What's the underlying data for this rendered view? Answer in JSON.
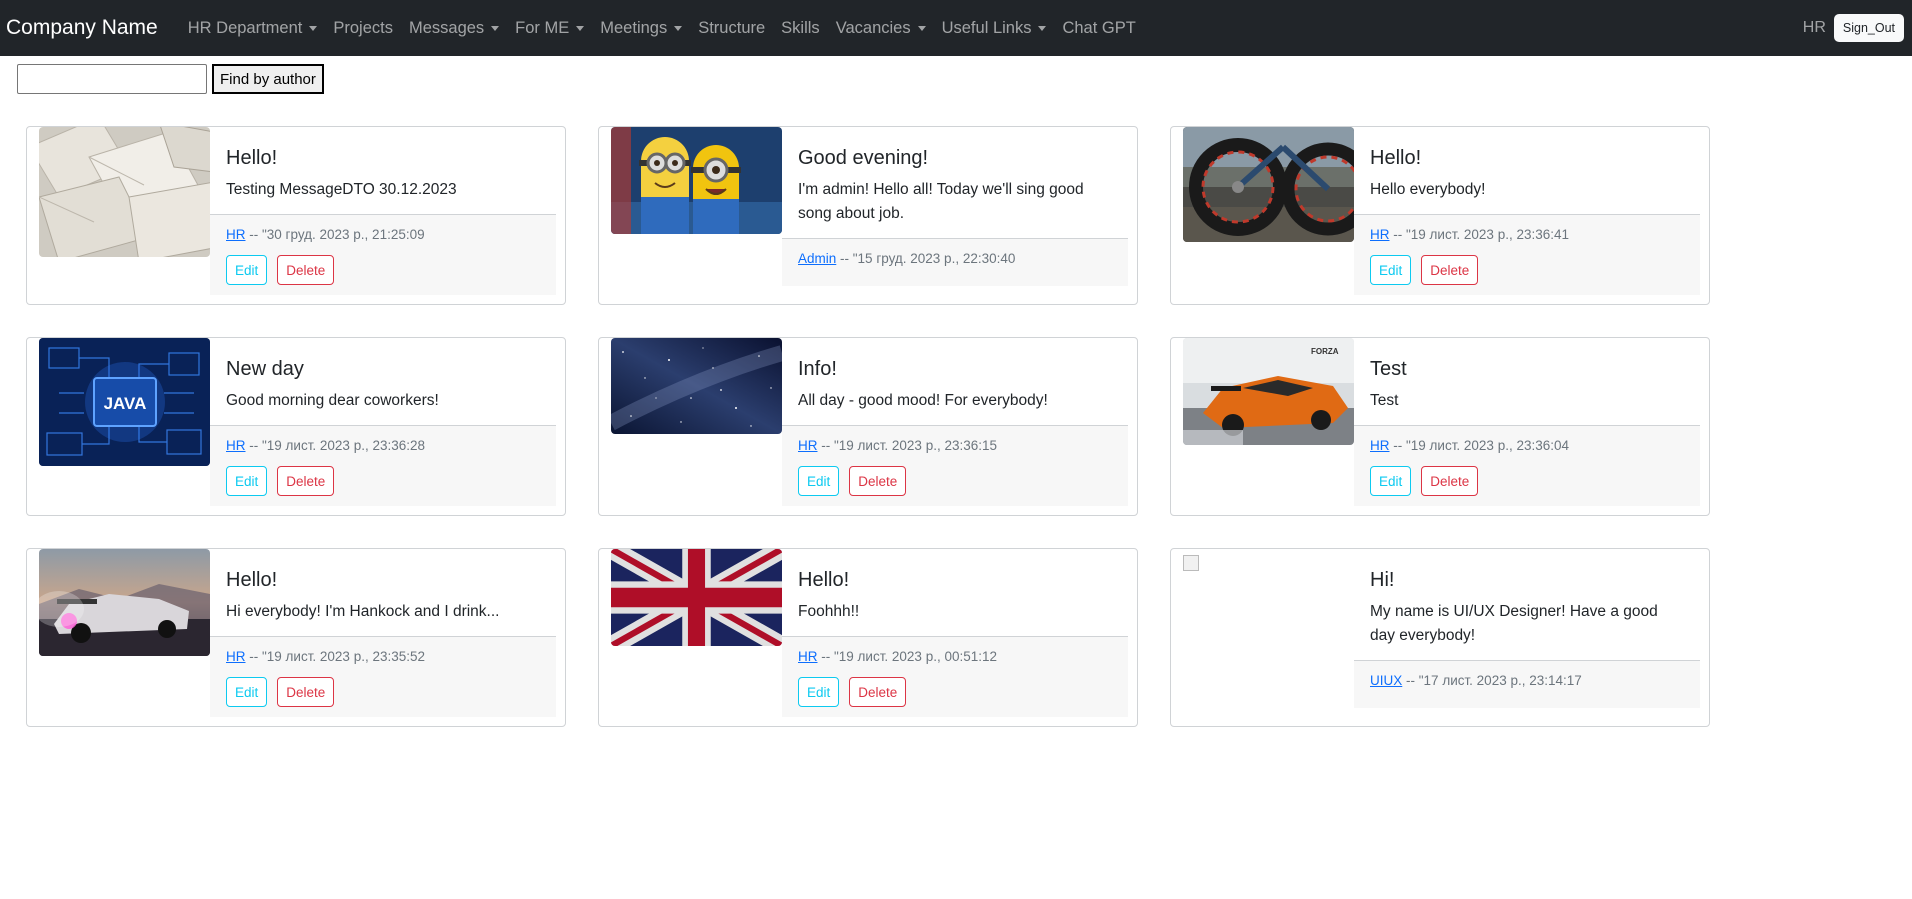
{
  "nav": {
    "brand": "Company Name",
    "items": [
      {
        "label": "HR Department",
        "dropdown": true
      },
      {
        "label": "Projects",
        "dropdown": false
      },
      {
        "label": "Messages",
        "dropdown": true
      },
      {
        "label": "For ME",
        "dropdown": true
      },
      {
        "label": "Meetings",
        "dropdown": true
      },
      {
        "label": "Structure",
        "dropdown": false
      },
      {
        "label": "Skills",
        "dropdown": false
      },
      {
        "label": "Vacancies",
        "dropdown": true
      },
      {
        "label": "Useful Links",
        "dropdown": true
      },
      {
        "label": "Chat GPT",
        "dropdown": false
      }
    ],
    "user": "HR",
    "signout": "Sign_Out"
  },
  "search": {
    "value": "",
    "button": "Find by author"
  },
  "actions": {
    "edit": "Edit",
    "delete": "Delete"
  },
  "cards": [
    {
      "title": "Hello!",
      "text": "Testing MessageDTO 30.12.2023",
      "author": "HR",
      "date": " -- \"30 груд. 2023 р., 21:25:09",
      "editable": true,
      "image": "envelopes"
    },
    {
      "title": "Good evening!",
      "text": "I'm admin! Hello all! Today we'll sing good song about job.",
      "author": "Admin",
      "date": " -- \"15 груд. 2023 р., 22:30:40",
      "editable": false,
      "image": "minions"
    },
    {
      "title": "Hello!",
      "text": "Hello everybody!",
      "author": "HR",
      "date": " -- \"19 лист. 2023 р., 23:36:41",
      "editable": true,
      "image": "bike"
    },
    {
      "title": "New day",
      "text": "Good morning dear coworkers!",
      "author": "HR",
      "date": " -- \"19 лист. 2023 р., 23:36:28",
      "editable": true,
      "image": "java",
      "image_text": "JAVA"
    },
    {
      "title": "Info!",
      "text": "All day - good mood! For everybody!",
      "author": "HR",
      "date": " -- \"19 лист. 2023 р., 23:36:15",
      "editable": true,
      "image": "space"
    },
    {
      "title": "Test",
      "text": "Test",
      "author": "HR",
      "date": " -- \"19 лист. 2023 р., 23:36:04",
      "editable": true,
      "image": "car",
      "image_text": "FORZA"
    },
    {
      "title": "Hello!",
      "text": "Hi everybody! I'm Hankock and I drink...",
      "author": "HR",
      "date": " -- \"19 лист. 2023 р., 23:35:52",
      "editable": true,
      "image": "racecar"
    },
    {
      "title": "Hello!",
      "text": "Foohhh!!",
      "author": "HR",
      "date": " -- \"19 лист. 2023 р., 00:51:12",
      "editable": true,
      "image": "flag"
    },
    {
      "title": "Hi!",
      "text": "My name is UI/UX Designer! Have a good day everybody!",
      "author": "UIUX",
      "date": " -- \"17 лист. 2023 р., 23:14:17",
      "editable": false,
      "image": "broken"
    }
  ]
}
